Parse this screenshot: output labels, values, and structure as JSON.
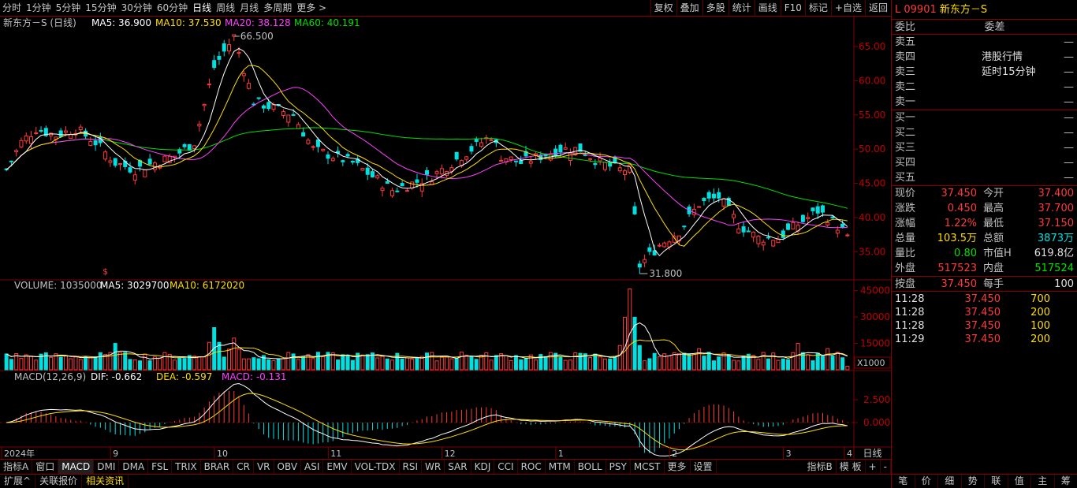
{
  "toolbar": {
    "left": [
      "分时",
      "1分钟",
      "5分钟",
      "15分钟",
      "30分钟",
      "60分钟",
      "日线",
      "周线",
      "月线",
      "多周期",
      "更多 >"
    ],
    "active": "日线",
    "right": [
      "复权",
      "叠加",
      "多股",
      "统计",
      "画线",
      "F10",
      "标记",
      "+自选",
      "返回"
    ]
  },
  "main_chart": {
    "stock_name": "新东方－S (日线)",
    "ma": [
      {
        "label": "MA5: 36.900",
        "color": "#ffffff"
      },
      {
        "label": "MA10: 37.530",
        "color": "#ffde00"
      },
      {
        "label": "MA20: 38.128",
        "color": "#ff40ff"
      },
      {
        "label": "MA60: 40.191",
        "color": "#00e000"
      }
    ],
    "y_ticks": [
      "65.00",
      "60.00",
      "55.00",
      "50.00",
      "45.00",
      "40.00",
      "35.00"
    ],
    "high_label": "66.500",
    "low_label": "31.800",
    "marker": "$"
  },
  "volume_chart": {
    "labels": [
      {
        "label": "VOLUME: 1035000",
        "color": "#c0c0c0"
      },
      {
        "label": "MA5: 3029700",
        "color": "#ffffff"
      },
      {
        "label": "MA10: 6172020",
        "color": "#ffde00"
      }
    ],
    "y_ticks": [
      "45000",
      "30000",
      "15000"
    ],
    "unit": "X1000"
  },
  "macd_chart": {
    "labels": [
      {
        "label": "MACD(12,26,9)",
        "color": "#c0c0c0"
      },
      {
        "label": "DIF: -0.662",
        "color": "#ffffff"
      },
      {
        "label": "DEA: -0.597",
        "color": "#ffde00"
      },
      {
        "label": "MACD: -0.131",
        "color": "#ff40ff"
      }
    ],
    "y_ticks": [
      "2.500",
      "0.000"
    ]
  },
  "x_axis": {
    "labels": [
      "2024年",
      "9",
      "10",
      "11",
      "12",
      "1",
      "2",
      "3",
      "4"
    ],
    "period": "日线"
  },
  "bottom_tabs": [
    "指标A",
    "窗口",
    "MACD",
    "DMI",
    "DMA",
    "FSL",
    "TRIX",
    "BRAR",
    "CR",
    "VR",
    "OBV",
    "ASI",
    "EMV",
    "VOL-TDX",
    "RSI",
    "WR",
    "SAR",
    "KDJ",
    "CCI",
    "ROC",
    "MTM",
    "BOLL",
    "PSY",
    "MCST",
    "更多",
    "设置"
  ],
  "bottom_tabs_right": [
    "指标B",
    "模 板",
    "+",
    "-"
  ],
  "bottom_row2": [
    "扩展^",
    "关联报价",
    "相关资讯"
  ],
  "right_panel": {
    "code": "L 09901",
    "name": "新东方－S",
    "weibi_label": "委比",
    "weicha_label": "委差",
    "sell": [
      "卖五",
      "卖四",
      "卖三",
      "卖二",
      "卖一"
    ],
    "buy": [
      "买一",
      "买二",
      "买三",
      "买四",
      "买五"
    ],
    "dash": "—",
    "notice1": "港股行情",
    "notice2": "延时15分钟",
    "quote": [
      {
        "l1": "现价",
        "v1": "37.450",
        "c1": "red",
        "l2": "今开",
        "v2": "37.400",
        "c2": "red"
      },
      {
        "l1": "涨跌",
        "v1": "0.450",
        "c1": "red",
        "l2": "最高",
        "v2": "37.700",
        "c2": "red"
      },
      {
        "l1": "涨幅",
        "v1": "1.22%",
        "c1": "red",
        "l2": "最低",
        "v2": "37.150",
        "c2": "red"
      },
      {
        "l1": "总量",
        "v1": "103.5万",
        "c1": "yel",
        "l2": "总额",
        "v2": "3873万",
        "c2": "cyn"
      },
      {
        "l1": "量比",
        "v1": "0.80",
        "c1": "grn",
        "l2": "市值H",
        "v2": "619.8亿",
        "c2": "wht"
      },
      {
        "l1": "外盘",
        "v1": "517523",
        "c1": "red",
        "l2": "内盘",
        "v2": "517524",
        "c2": "grn"
      }
    ],
    "anpan": {
      "l1": "按盘",
      "v1": "37.450",
      "l2": "每手",
      "v2": "100"
    },
    "ticks": [
      {
        "t": "11:28",
        "p": "37.450",
        "v": "700"
      },
      {
        "t": "11:28",
        "p": "37.450",
        "v": "200"
      },
      {
        "t": "11:28",
        "p": "37.450",
        "v": "100"
      },
      {
        "t": "11:29",
        "p": "37.450",
        "v": "200"
      }
    ],
    "tabs": [
      "笔",
      "价",
      "细",
      "势",
      "联",
      "值",
      "主",
      "筹"
    ]
  },
  "colors": {
    "up": "#ff3a3a",
    "down": "#00e0e0",
    "grid": "#800000",
    "ma5": "#ffffff",
    "ma10": "#ffde00",
    "ma20": "#ff40ff",
    "ma60": "#00e000"
  },
  "chart_data": {
    "type": "candlestick",
    "period": "daily",
    "main_ylim": [
      31,
      68
    ],
    "volume_ylim": [
      0,
      48000
    ],
    "macd_ylim": [
      -2.5,
      5
    ],
    "price_path": [
      [
        0,
        47
      ],
      [
        3,
        51
      ],
      [
        6,
        53
      ],
      [
        10,
        52
      ],
      [
        14,
        53
      ],
      [
        18,
        51
      ],
      [
        22,
        48
      ],
      [
        26,
        47
      ],
      [
        30,
        48
      ],
      [
        34,
        49
      ],
      [
        38,
        51
      ],
      [
        42,
        62
      ],
      [
        46,
        66.5
      ],
      [
        50,
        57
      ],
      [
        54,
        56
      ],
      [
        58,
        55
      ],
      [
        62,
        50
      ],
      [
        66,
        49
      ],
      [
        70,
        48
      ],
      [
        74,
        46
      ],
      [
        78,
        44
      ],
      [
        82,
        45
      ],
      [
        86,
        46
      ],
      [
        90,
        48
      ],
      [
        94,
        50
      ],
      [
        98,
        52
      ],
      [
        100,
        49
      ],
      [
        104,
        48
      ],
      [
        108,
        49
      ],
      [
        112,
        50
      ],
      [
        116,
        50
      ],
      [
        120,
        48
      ],
      [
        124,
        47
      ],
      [
        126,
        47
      ],
      [
        128,
        33
      ],
      [
        132,
        36
      ],
      [
        136,
        38
      ],
      [
        140,
        42
      ],
      [
        144,
        43
      ],
      [
        148,
        39
      ],
      [
        152,
        37
      ],
      [
        156,
        37
      ],
      [
        160,
        39
      ],
      [
        164,
        41
      ],
      [
        166,
        40
      ],
      [
        170,
        37.45
      ]
    ],
    "volume_peaks": [
      [
        0,
        9000
      ],
      [
        22,
        15000
      ],
      [
        42,
        24000
      ],
      [
        46,
        18000
      ],
      [
        58,
        9000
      ],
      [
        92,
        10000
      ],
      [
        126,
        46000
      ],
      [
        140,
        12000
      ],
      [
        160,
        15000
      ],
      [
        166,
        12000
      ],
      [
        170,
        2000
      ]
    ]
  }
}
